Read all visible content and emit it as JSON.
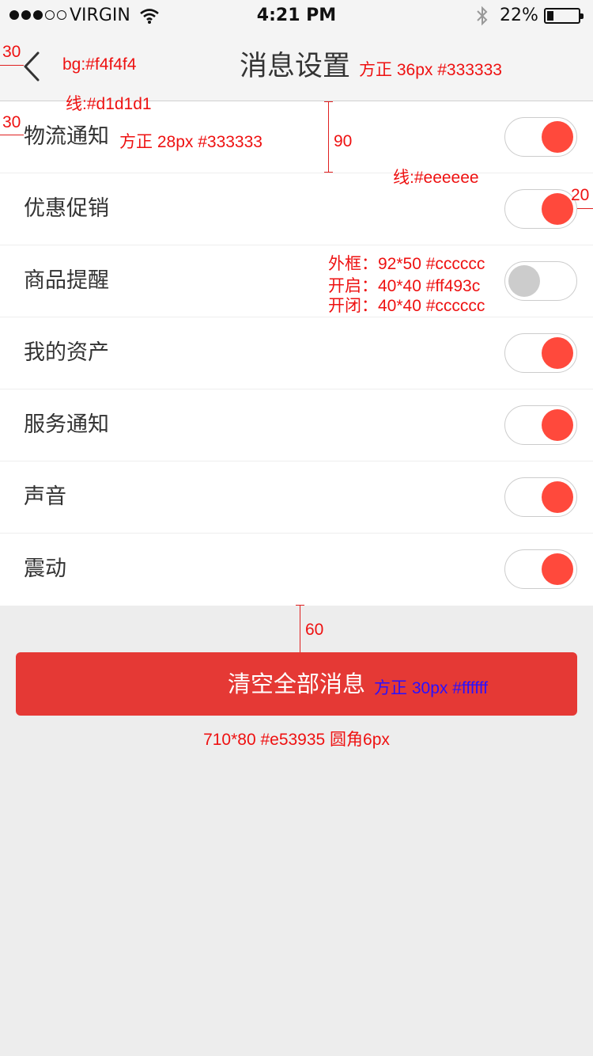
{
  "status_bar": {
    "carrier": "VIRGIN",
    "time": "4:21 PM",
    "battery": "22%",
    "battery_level": 0.22
  },
  "nav": {
    "title": "消息设置"
  },
  "settings": [
    {
      "label": "物流通知",
      "on": true
    },
    {
      "label": "优惠促销",
      "on": true
    },
    {
      "label": "商品提醒",
      "on": false
    },
    {
      "label": "我的资产",
      "on": true
    },
    {
      "label": "服务通知",
      "on": true
    },
    {
      "label": "声音",
      "on": true
    },
    {
      "label": "震动",
      "on": true
    }
  ],
  "clear_button": {
    "label": "清空全部消息"
  },
  "annotations": {
    "back_margin": "30",
    "nav_bg": "bg:#f4f4f4",
    "nav_title_spec": "方正 36px #333333",
    "nav_line": "线:#d1d1d1",
    "row_margin": "30",
    "row_label_spec": "方正 28px #333333",
    "row_height": "90",
    "row_line": "线:#eeeeee",
    "toggle_margin": "20",
    "toggle_frame": "外框：92*50 #cccccc",
    "toggle_on": "开启：40*40 #ff493c",
    "toggle_off": "开闭：40*40 #cccccc",
    "button_gap": "60",
    "button_label_spec": "方正 30px #ffffff",
    "button_spec": "710*80 #e53935 圆角6px"
  },
  "colors": {
    "nav_bg": "#f4f4f4",
    "nav_line": "#d1d1d1",
    "row_line": "#eeeeee",
    "text": "#333333",
    "toggle_frame": "#cccccc",
    "toggle_on": "#ff493c",
    "toggle_off": "#cccccc",
    "button": "#e53935"
  }
}
